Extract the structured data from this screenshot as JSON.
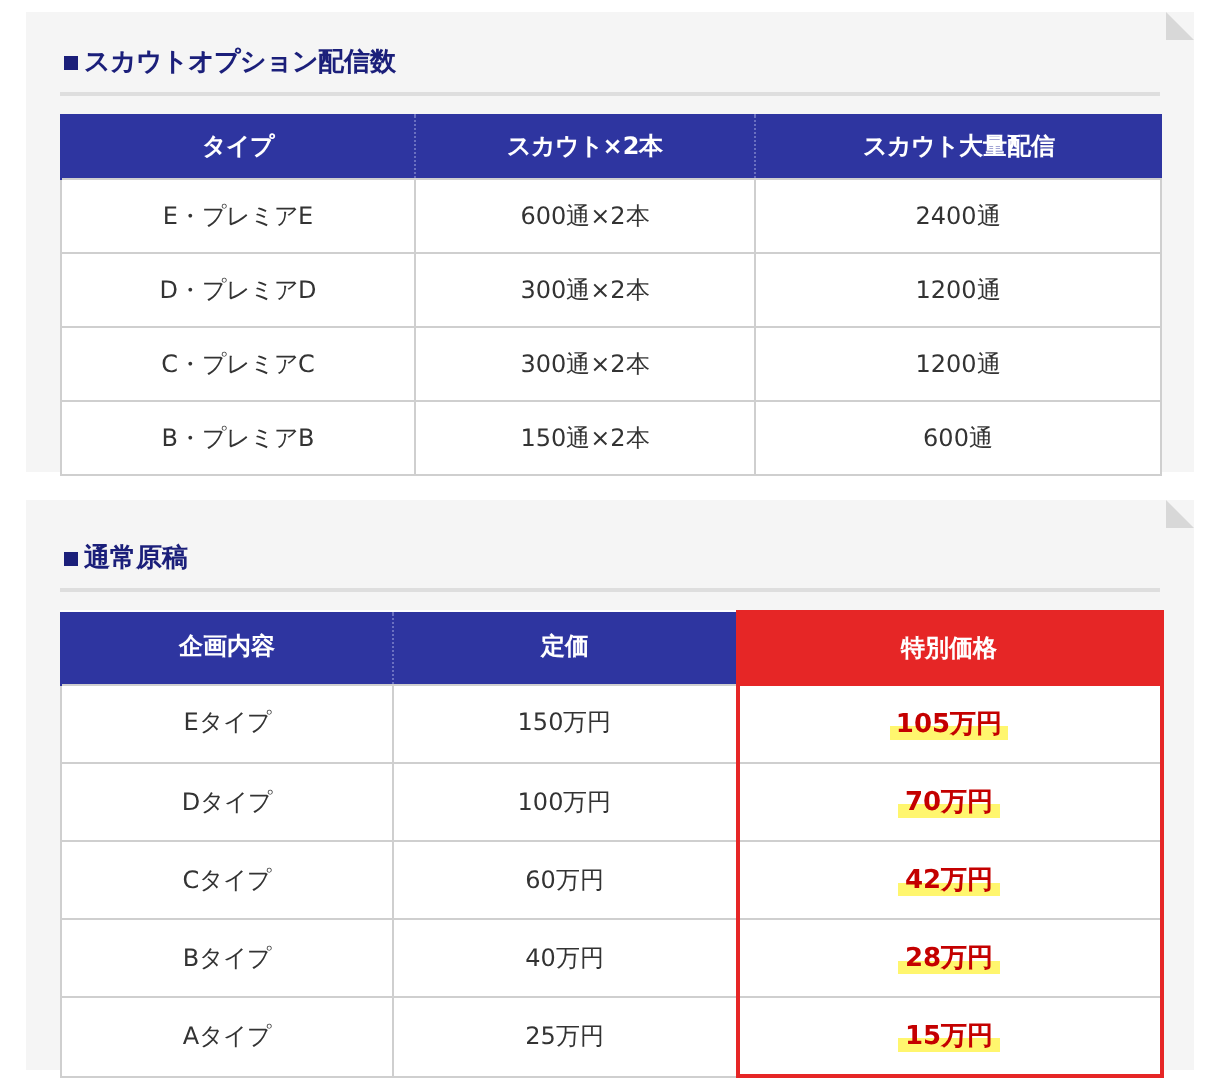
{
  "sections": [
    {
      "title": "スカウトオプション配信数",
      "columns": [
        {
          "label": "タイプ",
          "highlight": false
        },
        {
          "label": "スカウト×2本",
          "highlight": false
        },
        {
          "label": "スカウト大量配信",
          "highlight": false
        }
      ],
      "rows": [
        [
          "E・プレミアE",
          "600通×2本",
          "2400通"
        ],
        [
          "D・プレミアD",
          "300通×2本",
          "1200通"
        ],
        [
          "C・プレミアC",
          "300通×2本",
          "1200通"
        ],
        [
          "B・プレミアB",
          "150通×2本",
          "600通"
        ]
      ]
    },
    {
      "title": "通常原稿",
      "columns": [
        {
          "label": "企画内容",
          "highlight": false
        },
        {
          "label": "定価",
          "highlight": false
        },
        {
          "label": "特別価格",
          "highlight": true
        }
      ],
      "rows": [
        [
          "Eタイプ",
          "150万円",
          "105万円"
        ],
        [
          "Dタイプ",
          "100万円",
          "70万円"
        ],
        [
          "Cタイプ",
          "60万円",
          "42万円"
        ],
        [
          "Bタイプ",
          "40万円",
          "28万円"
        ],
        [
          "Aタイプ",
          "25万円",
          "15万円"
        ]
      ]
    }
  ]
}
